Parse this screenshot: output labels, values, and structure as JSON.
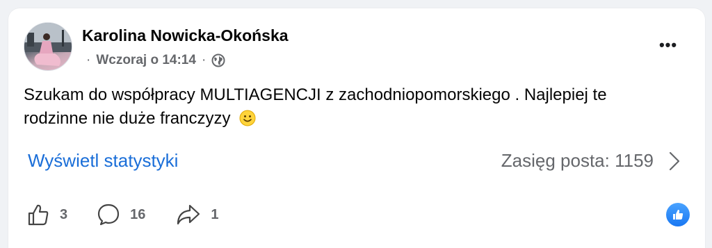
{
  "post": {
    "author": "Karolina Nowicka-Okońska",
    "timestamp": "Wczoraj o 14:14",
    "audience_icon": "globe-icon",
    "text_line1": "Szukam do współpracy MULTIAGENCJI z  zachodniopomorskiego . Najlepiej te",
    "text_line2": "rodzinne nie duże franczyzy",
    "emoji": "🙂"
  },
  "stats": {
    "view_label": "Wyświetl statystyki",
    "reach_label": "Zasięg posta: 1159"
  },
  "actions": {
    "likes": "3",
    "comments": "16",
    "shares": "1"
  },
  "colors": {
    "link": "#1a6ed8",
    "muted": "#65676b",
    "like_blue": "#1877f2"
  }
}
